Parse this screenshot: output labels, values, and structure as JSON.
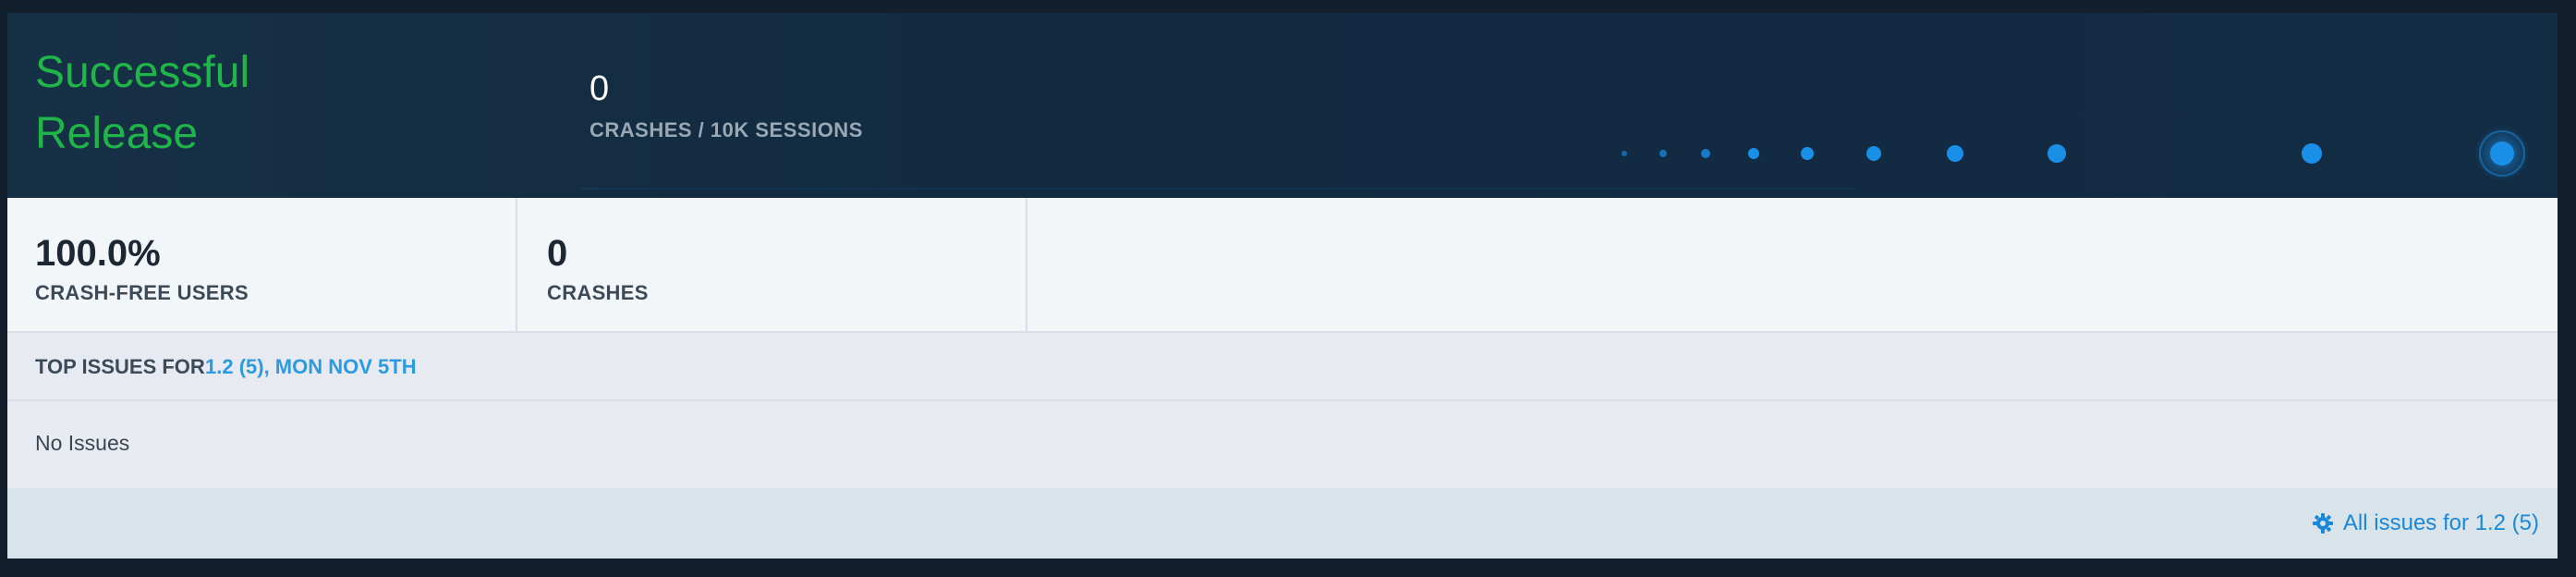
{
  "hero": {
    "title": "Successful Release",
    "stat_value": "0",
    "stat_label": "CRASHES / 10K SESSIONS",
    "accent_color": "#1fb548",
    "sparkline_color": "#1a8fe8"
  },
  "stats": [
    {
      "value": "100.0%",
      "label": "CRASH-FREE USERS"
    },
    {
      "value": "0",
      "label": "CRASHES"
    }
  ],
  "top_issues": {
    "label": "TOP ISSUES FOR",
    "release_link": "1.2 (5), MON NOV 5TH",
    "empty_text": "No Issues"
  },
  "footer": {
    "link_label": "All issues for 1.2 (5)",
    "icon": "crashlytics-gear-icon"
  }
}
